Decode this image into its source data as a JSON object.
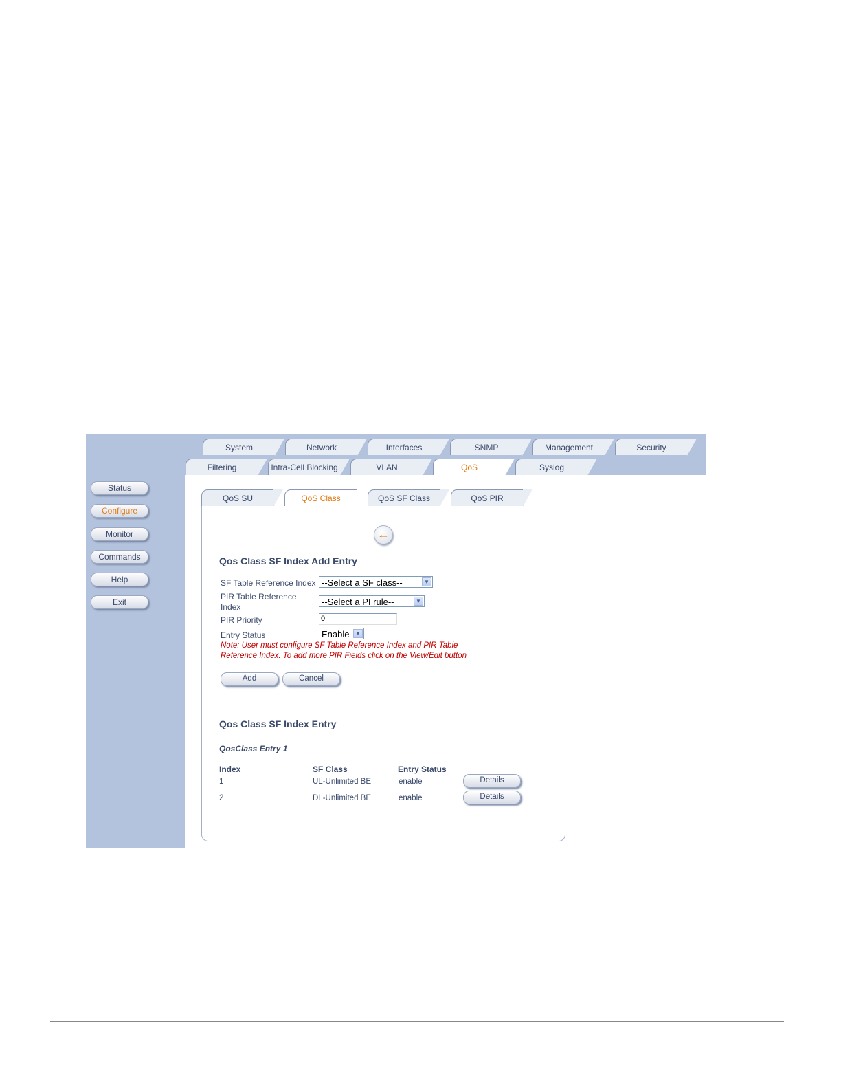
{
  "main_tabs": [
    "System",
    "Network",
    "Interfaces",
    "SNMP",
    "Management",
    "Security"
  ],
  "sub_tabs": [
    "Filtering",
    "Intra-Cell Blocking",
    "VLAN",
    "QoS",
    "Syslog"
  ],
  "sub_tab_active": "QoS",
  "qos_tabs": [
    "QoS SU",
    "QoS Class",
    "QoS SF Class",
    "QoS PIR"
  ],
  "qos_tab_active": "QoS Class",
  "nav": [
    "Status",
    "Configure",
    "Monitor",
    "Commands",
    "Help",
    "Exit"
  ],
  "nav_active": "Configure",
  "form": {
    "title": "Qos Class SF Index Add Entry",
    "sf_label": "SF Table Reference Index",
    "sf_value": "--Select a SF class--",
    "pir_label_1": "PIR Table Reference",
    "pir_label_2": "Index",
    "pir_value": "--Select a PI rule--",
    "priority_label": "PIR Priority",
    "priority_value": "0",
    "status_label": "Entry Status",
    "status_value": "Enable",
    "note_1": "Note: User must configure SF Table Reference Index and PIR Table",
    "note_2": "Reference Index. To add more PIR Fields click on the View/Edit button",
    "add_label": "Add",
    "cancel_label": "Cancel"
  },
  "entries": {
    "title": "Qos Class SF Index Entry",
    "subtitle": "QosClass Entry 1",
    "headers": [
      "Index",
      "SF Class",
      "Entry Status"
    ],
    "rows": [
      {
        "index": "1",
        "sf_class": "UL-Unlimited BE",
        "status": "enable",
        "action": "Details"
      },
      {
        "index": "2",
        "sf_class": "DL-Unlimited BE",
        "status": "enable",
        "action": "Details"
      }
    ]
  },
  "colors": {
    "nav_bg": "#b3c2dd",
    "accent": "#e07b14",
    "note": "#c00000"
  }
}
